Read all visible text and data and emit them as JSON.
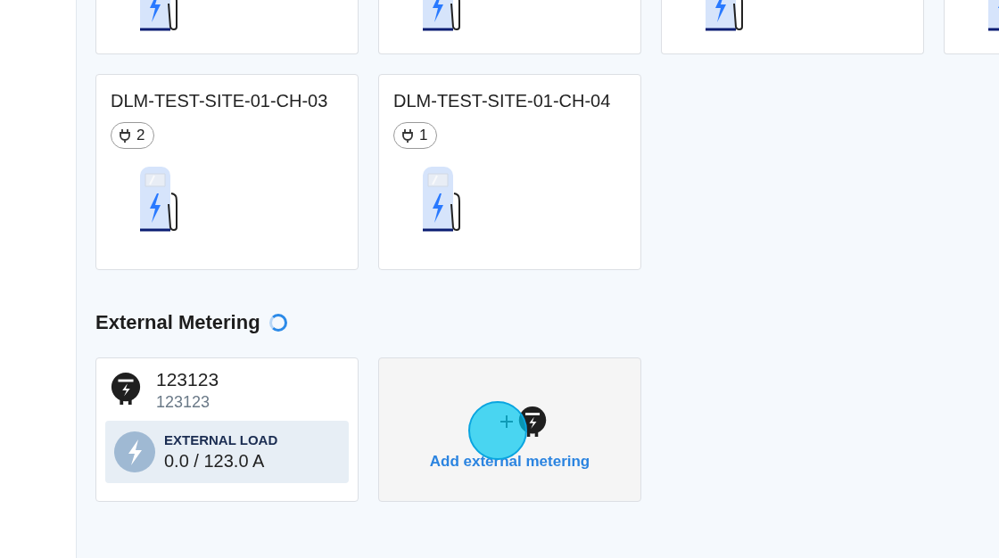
{
  "partial_chargers": [
    {
      "kind": "charger"
    },
    {
      "kind": "charger"
    },
    {
      "kind": "charger"
    },
    {
      "kind": "charger"
    }
  ],
  "chargers": [
    {
      "name": "DLM-TEST-SITE-01-CH-03",
      "connectors": "2"
    },
    {
      "name": "DLM-TEST-SITE-01-CH-04",
      "connectors": "1"
    }
  ],
  "external_metering": {
    "title": "External Metering",
    "loading": true,
    "meters": [
      {
        "name": "123123",
        "subtitle": "123123",
        "load_label": "EXTERNAL LOAD",
        "load_value": "0.0 / 123.0 A"
      }
    ],
    "add_button": "Add external metering"
  },
  "click_indicator": true
}
